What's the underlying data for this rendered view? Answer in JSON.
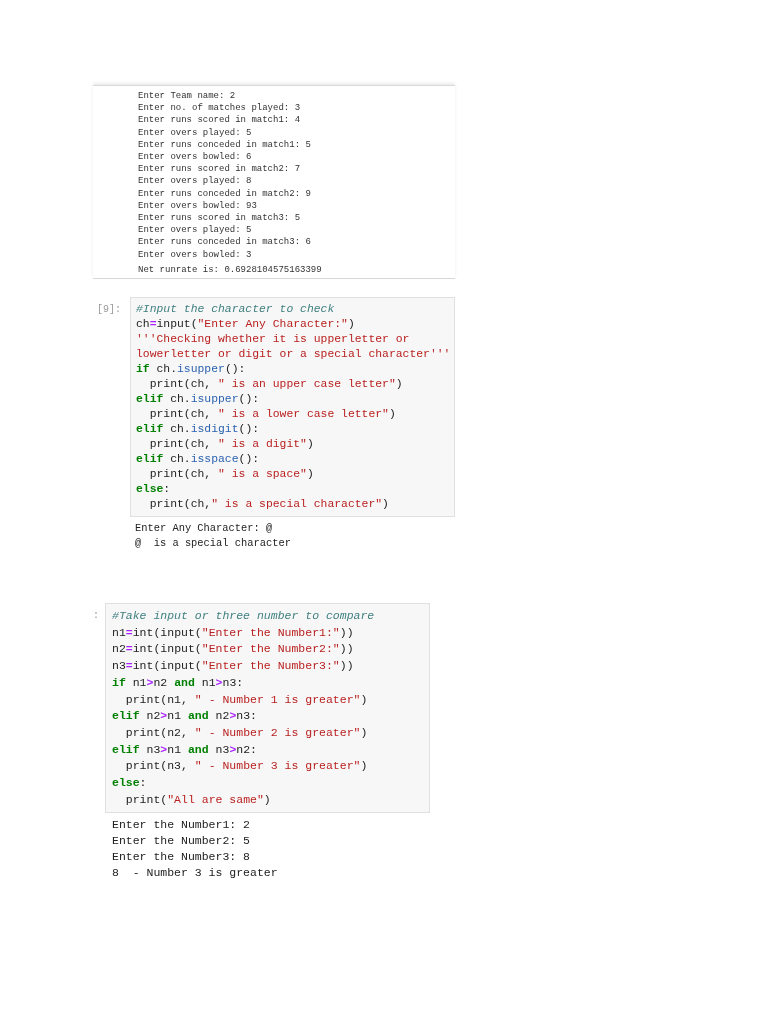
{
  "cells": [
    {
      "output": [
        "Enter Team name: 2",
        "Enter no. of matches played: 3",
        "Enter runs scored in match1: 4",
        "Enter overs played: 5",
        "Enter runs conceded in match1: 5",
        "Enter overs bowled: 6",
        "Enter runs scored in match2: 7",
        "Enter overs played: 8",
        "Enter runs conceded in match2: 9",
        "Enter overs bowled: 93",
        "Enter runs scored in match3: 5",
        "Enter overs played: 5",
        "Enter runs conceded in match3: 6",
        "Enter overs bowled: 3",
        "Net runrate is: 0.6928104575163399"
      ]
    },
    {
      "prompt": "[9]:",
      "code": [
        [
          {
            "kind": "comment",
            "text": "#Input the character to check"
          }
        ],
        [
          {
            "kind": "plain",
            "text": "ch"
          },
          {
            "kind": "op",
            "text": "="
          },
          {
            "kind": "plain",
            "text": "input("
          },
          {
            "kind": "str",
            "text": "\"Enter Any Character:\""
          },
          {
            "kind": "plain",
            "text": ")"
          }
        ],
        [
          {
            "kind": "str",
            "text": "'''Checking whether it is upperletter or"
          }
        ],
        [
          {
            "kind": "str",
            "text": "lowerletter or digit or a special character'''"
          }
        ],
        [
          {
            "kind": "kw",
            "text": "if"
          },
          {
            "kind": "plain",
            "text": " ch."
          },
          {
            "kind": "fn",
            "text": "isupper"
          },
          {
            "kind": "plain",
            "text": "():"
          }
        ],
        [
          {
            "kind": "plain",
            "text": "  print(ch, "
          },
          {
            "kind": "str",
            "text": "\" is an upper case letter\""
          },
          {
            "kind": "plain",
            "text": ")"
          }
        ],
        [
          {
            "kind": "kw",
            "text": "elif"
          },
          {
            "kind": "plain",
            "text": " ch."
          },
          {
            "kind": "fn",
            "text": "isupper"
          },
          {
            "kind": "plain",
            "text": "():"
          }
        ],
        [
          {
            "kind": "plain",
            "text": "  print(ch, "
          },
          {
            "kind": "str",
            "text": "\" is a lower case letter\""
          },
          {
            "kind": "plain",
            "text": ")"
          }
        ],
        [
          {
            "kind": "kw",
            "text": "elif"
          },
          {
            "kind": "plain",
            "text": " ch."
          },
          {
            "kind": "fn",
            "text": "isdigit"
          },
          {
            "kind": "plain",
            "text": "():"
          }
        ],
        [
          {
            "kind": "plain",
            "text": "  print(ch, "
          },
          {
            "kind": "str",
            "text": "\" is a digit\""
          },
          {
            "kind": "plain",
            "text": ")"
          }
        ],
        [
          {
            "kind": "kw",
            "text": "elif"
          },
          {
            "kind": "plain",
            "text": " ch."
          },
          {
            "kind": "fn",
            "text": "isspace"
          },
          {
            "kind": "plain",
            "text": "():"
          }
        ],
        [
          {
            "kind": "plain",
            "text": "  print(ch, "
          },
          {
            "kind": "str",
            "text": "\" is a space\""
          },
          {
            "kind": "plain",
            "text": ")"
          }
        ],
        [
          {
            "kind": "kw",
            "text": "else"
          },
          {
            "kind": "plain",
            "text": ":"
          }
        ],
        [
          {
            "kind": "plain",
            "text": "  print(ch,"
          },
          {
            "kind": "str",
            "text": "\" is a special character\""
          },
          {
            "kind": "plain",
            "text": ")"
          }
        ]
      ],
      "output": [
        "Enter Any Character: @",
        "@  is a special character"
      ]
    },
    {
      "prompt": ":",
      "code": [
        [
          {
            "kind": "comment",
            "text": "#Take input or three number to compare"
          }
        ],
        [
          {
            "kind": "plain",
            "text": "n1"
          },
          {
            "kind": "op",
            "text": "="
          },
          {
            "kind": "plain",
            "text": "int(input("
          },
          {
            "kind": "str",
            "text": "\"Enter the Number1:\""
          },
          {
            "kind": "plain",
            "text": "))"
          }
        ],
        [
          {
            "kind": "plain",
            "text": "n2"
          },
          {
            "kind": "op",
            "text": "="
          },
          {
            "kind": "plain",
            "text": "int(input("
          },
          {
            "kind": "str",
            "text": "\"Enter the Number2:\""
          },
          {
            "kind": "plain",
            "text": "))"
          }
        ],
        [
          {
            "kind": "plain",
            "text": "n3"
          },
          {
            "kind": "op",
            "text": "="
          },
          {
            "kind": "plain",
            "text": "int(input("
          },
          {
            "kind": "str",
            "text": "\"Enter the Number3:\""
          },
          {
            "kind": "plain",
            "text": "))"
          }
        ],
        [
          {
            "kind": "kw",
            "text": "if"
          },
          {
            "kind": "plain",
            "text": " n1"
          },
          {
            "kind": "op",
            "text": ">"
          },
          {
            "kind": "plain",
            "text": "n2 "
          },
          {
            "kind": "kw",
            "text": "and"
          },
          {
            "kind": "plain",
            "text": " n1"
          },
          {
            "kind": "op",
            "text": ">"
          },
          {
            "kind": "plain",
            "text": "n3:"
          }
        ],
        [
          {
            "kind": "plain",
            "text": "  print(n1, "
          },
          {
            "kind": "str",
            "text": "\" - Number 1 is greater\""
          },
          {
            "kind": "plain",
            "text": ")"
          }
        ],
        [
          {
            "kind": "kw",
            "text": "elif"
          },
          {
            "kind": "plain",
            "text": " n2"
          },
          {
            "kind": "op",
            "text": ">"
          },
          {
            "kind": "plain",
            "text": "n1 "
          },
          {
            "kind": "kw",
            "text": "and"
          },
          {
            "kind": "plain",
            "text": " n2"
          },
          {
            "kind": "op",
            "text": ">"
          },
          {
            "kind": "plain",
            "text": "n3:"
          }
        ],
        [
          {
            "kind": "plain",
            "text": "  print(n2, "
          },
          {
            "kind": "str",
            "text": "\" - Number 2 is greater\""
          },
          {
            "kind": "plain",
            "text": ")"
          }
        ],
        [
          {
            "kind": "kw",
            "text": "elif"
          },
          {
            "kind": "plain",
            "text": " n3"
          },
          {
            "kind": "op",
            "text": ">"
          },
          {
            "kind": "plain",
            "text": "n1 "
          },
          {
            "kind": "kw",
            "text": "and"
          },
          {
            "kind": "plain",
            "text": " n3"
          },
          {
            "kind": "op",
            "text": ">"
          },
          {
            "kind": "plain",
            "text": "n2:"
          }
        ],
        [
          {
            "kind": "plain",
            "text": "  print(n3, "
          },
          {
            "kind": "str",
            "text": "\" - Number 3 is greater\""
          },
          {
            "kind": "plain",
            "text": ")"
          }
        ],
        [
          {
            "kind": "kw",
            "text": "else"
          },
          {
            "kind": "plain",
            "text": ":"
          }
        ],
        [
          {
            "kind": "plain",
            "text": "  print("
          },
          {
            "kind": "str",
            "text": "\"All are same\""
          },
          {
            "kind": "plain",
            "text": ")"
          }
        ]
      ],
      "output": [
        "Enter the Number1: 2",
        "Enter the Number2: 5",
        "Enter the Number3: 8",
        "8  - Number 3 is greater"
      ]
    }
  ]
}
